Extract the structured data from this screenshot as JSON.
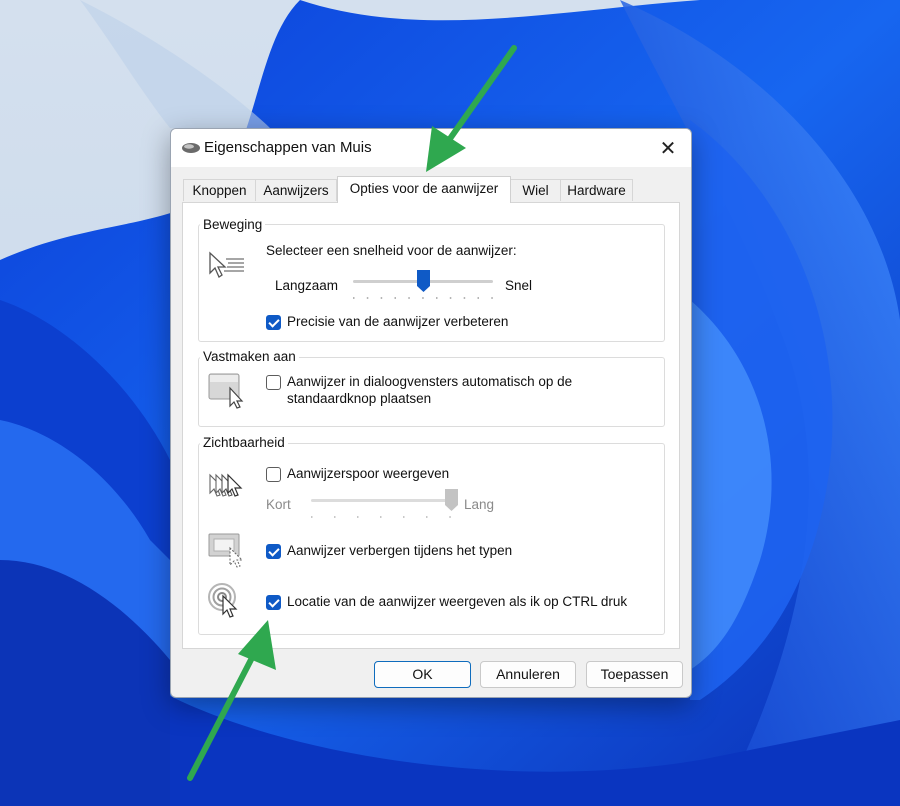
{
  "window": {
    "title": "Eigenschappen van Muis"
  },
  "tabs": [
    {
      "label": "Knoppen"
    },
    {
      "label": "Aanwijzers"
    },
    {
      "label": "Opties voor de aanwijzer"
    },
    {
      "label": "Wiel"
    },
    {
      "label": "Hardware"
    }
  ],
  "active_tab": "Opties voor de aanwijzer",
  "motion": {
    "title": "Beweging",
    "prompt": "Selecteer een snelheid voor de aanwijzer:",
    "slow_label": "Langzaam",
    "fast_label": "Snel",
    "speed_level": 0.5,
    "precision_label": "Precisie van de aanwijzer verbeteren",
    "precision_checked": true
  },
  "snap": {
    "title": "Vastmaken aan",
    "line1": "Aanwijzer in dialoogvensters automatisch op de",
    "line2": "standaardknop plaatsen",
    "checked": false
  },
  "visibility": {
    "title": "Zichtbaarheid",
    "trail_label": "Aanwijzerspoor weergeven",
    "trail_checked": false,
    "short_label": "Kort",
    "long_label": "Lang",
    "trail_level": 1.0,
    "hide_label": "Aanwijzer verbergen tijdens het typen",
    "hide_checked": true,
    "ctrl_label": "Locatie van de aanwijzer weergeven als ik op CTRL druk",
    "ctrl_checked": true
  },
  "buttons": {
    "ok": "OK",
    "cancel": "Annuleren",
    "apply": "Toepassen"
  },
  "colors": {
    "accent": "#0f5ac6",
    "wallpaper": "#1a56e8",
    "annotation_arrow": "#2fa84f"
  }
}
